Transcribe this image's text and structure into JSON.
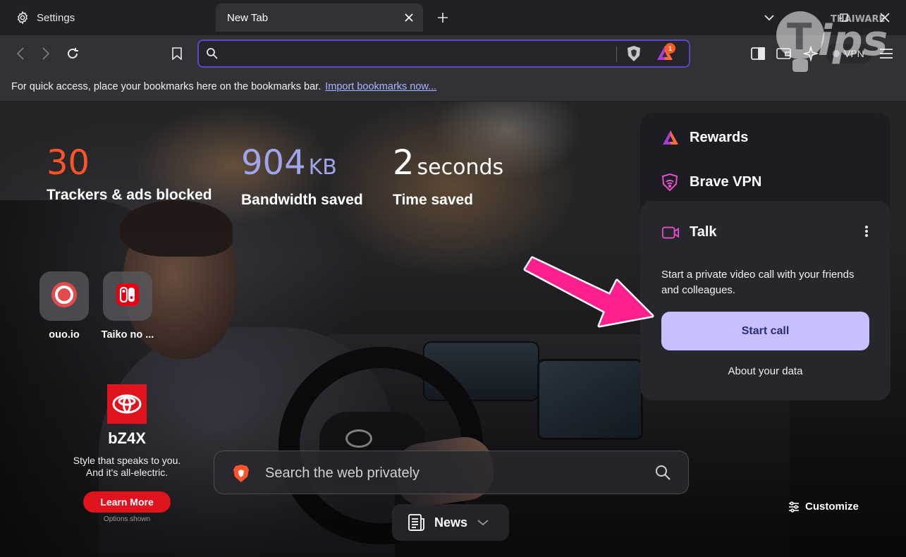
{
  "tabs": {
    "settings_label": "Settings",
    "newtab_label": "New Tab"
  },
  "toolbar": {
    "address_value": "",
    "rewards_badge": "1",
    "vpn_label": "VPN"
  },
  "bookmarks": {
    "hint": "For quick access, place your bookmarks here on the bookmarks bar.",
    "import_link": "Import bookmarks now..."
  },
  "stats": [
    {
      "value": "30",
      "unit": "",
      "label": "Trackers & ads blocked",
      "color": "#fb542b"
    },
    {
      "value": "904",
      "unit": "KB",
      "label": "Bandwidth saved",
      "color": "#a0a5eb"
    },
    {
      "value": "2",
      "unit": "seconds",
      "label": "Time saved",
      "color": "#ffffff"
    }
  ],
  "top_sites": [
    {
      "label": "ouo.io"
    },
    {
      "label": "Taiko no ..."
    }
  ],
  "sponsored": {
    "model": "bZ4X",
    "tagline": "Style that speaks to you.\nAnd it's all-electric.",
    "cta": "Learn More",
    "options_note": "Options shown"
  },
  "search": {
    "placeholder": "Search the web privately"
  },
  "news": {
    "label": "News"
  },
  "customize": {
    "label": "Customize"
  },
  "cards": {
    "rewards": "Rewards",
    "vpn": "Brave VPN",
    "talk": {
      "title": "Talk",
      "description": "Start a private video call with your friends and colleagues.",
      "start_call": "Start call",
      "about_data": "About your data"
    }
  },
  "watermark": {
    "brand": "THAIWARE"
  },
  "colors": {
    "accent": "#5a48c9",
    "start_call_bg": "#c5c0ff",
    "brand_orange": "#fb542b",
    "arrow_pink": "#ff1f8e"
  }
}
